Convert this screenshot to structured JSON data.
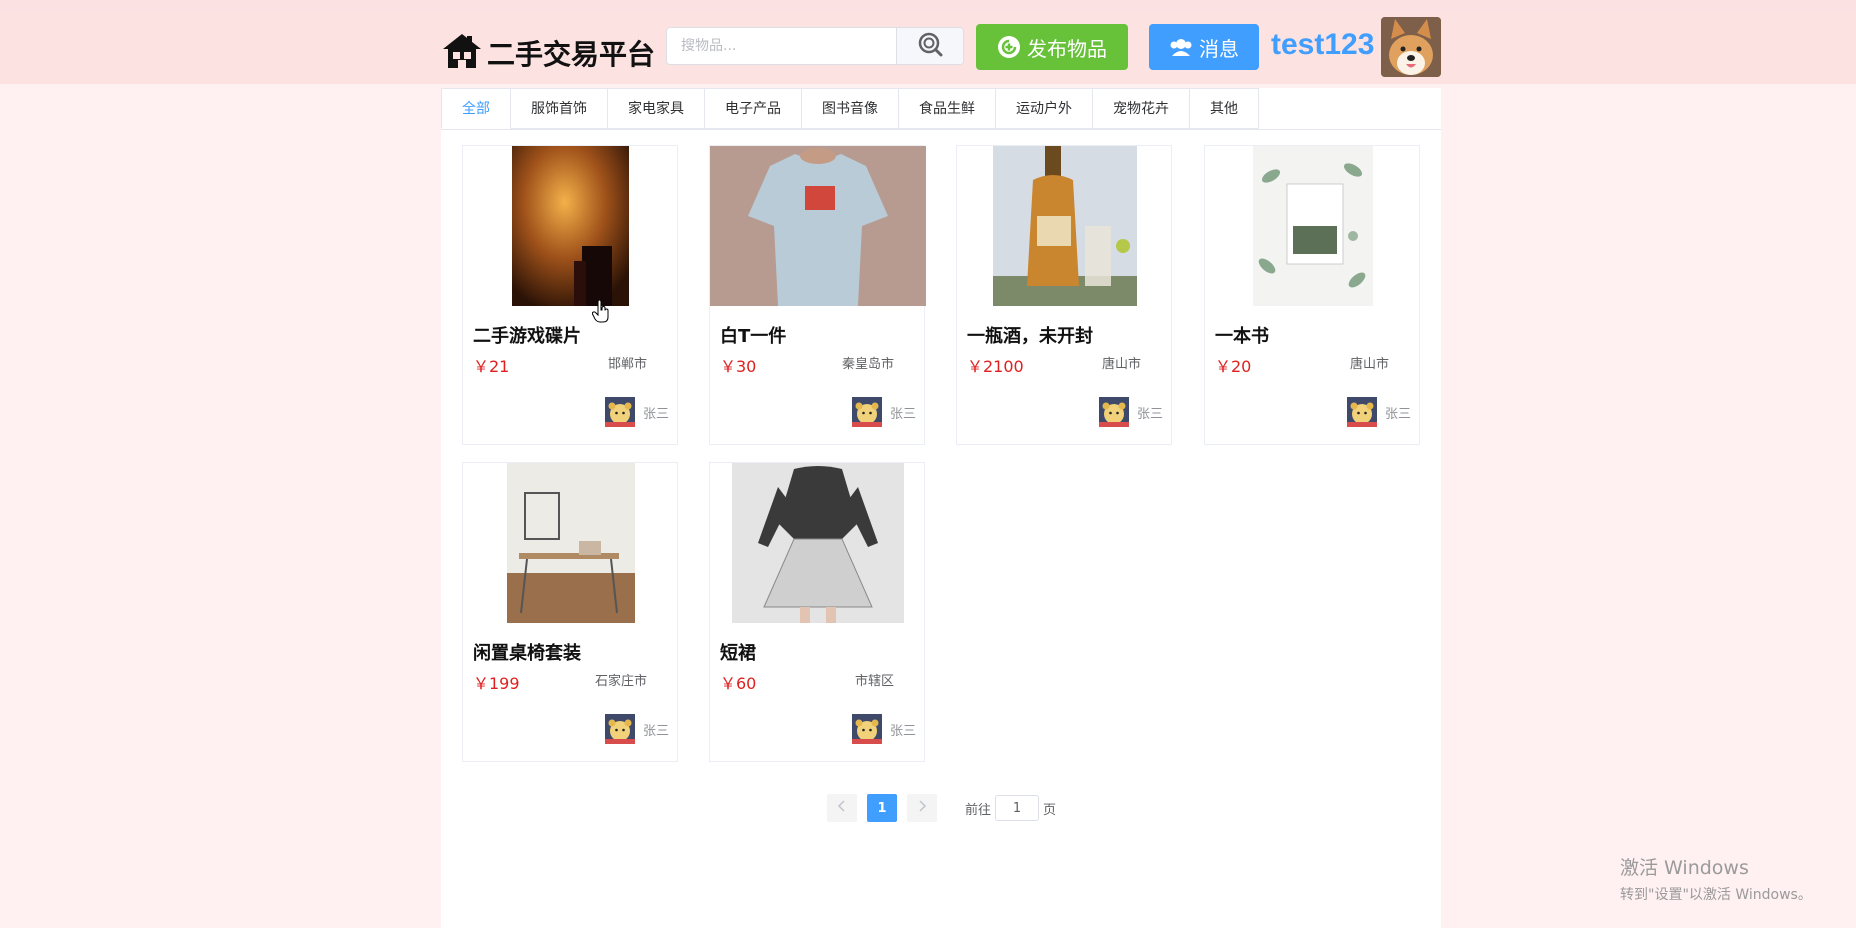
{
  "header": {
    "site_title": "二手交易平台",
    "search_placeholder": "搜物品...",
    "publish_label": "发布物品",
    "message_label": "消息",
    "username": "test123"
  },
  "tabs": [
    {
      "label": "全部",
      "active": true
    },
    {
      "label": "服饰首饰"
    },
    {
      "label": "家电家具"
    },
    {
      "label": "电子产品"
    },
    {
      "label": "图书音像"
    },
    {
      "label": "食品生鲜"
    },
    {
      "label": "运动户外"
    },
    {
      "label": "宠物花卉"
    },
    {
      "label": "其他"
    }
  ],
  "products": [
    {
      "title": "二手游戏碟片",
      "price": "￥21",
      "city": "邯郸市",
      "seller": "张三"
    },
    {
      "title": "白T一件",
      "price": "￥30",
      "city": "秦皇岛市",
      "seller": "张三"
    },
    {
      "title": "一瓶酒，未开封",
      "price": "￥2100",
      "city": "唐山市",
      "seller": "张三"
    },
    {
      "title": "一本书",
      "price": "￥20",
      "city": "唐山市",
      "seller": "张三"
    },
    {
      "title": "闲置桌椅套装",
      "price": "￥199",
      "city": "石家庄市",
      "seller": "张三"
    },
    {
      "title": "短裙",
      "price": "￥60",
      "city": "市辖区",
      "seller": "张三"
    }
  ],
  "pagination": {
    "current_page": "1",
    "prev_icon": "chevron-left-icon",
    "next_icon": "chevron-right-icon",
    "goto_label": "前往",
    "goto_value": "1",
    "page_suffix": "页"
  },
  "watermark": {
    "line1": "激活 Windows",
    "line2": "转到\"设置\"以激活 Windows。"
  },
  "colors": {
    "header_bg": "#fde2e2",
    "page_bg": "#fff0f2",
    "publish_green": "#67c23a",
    "primary_blue": "#409eff",
    "price_red": "#e02020"
  }
}
